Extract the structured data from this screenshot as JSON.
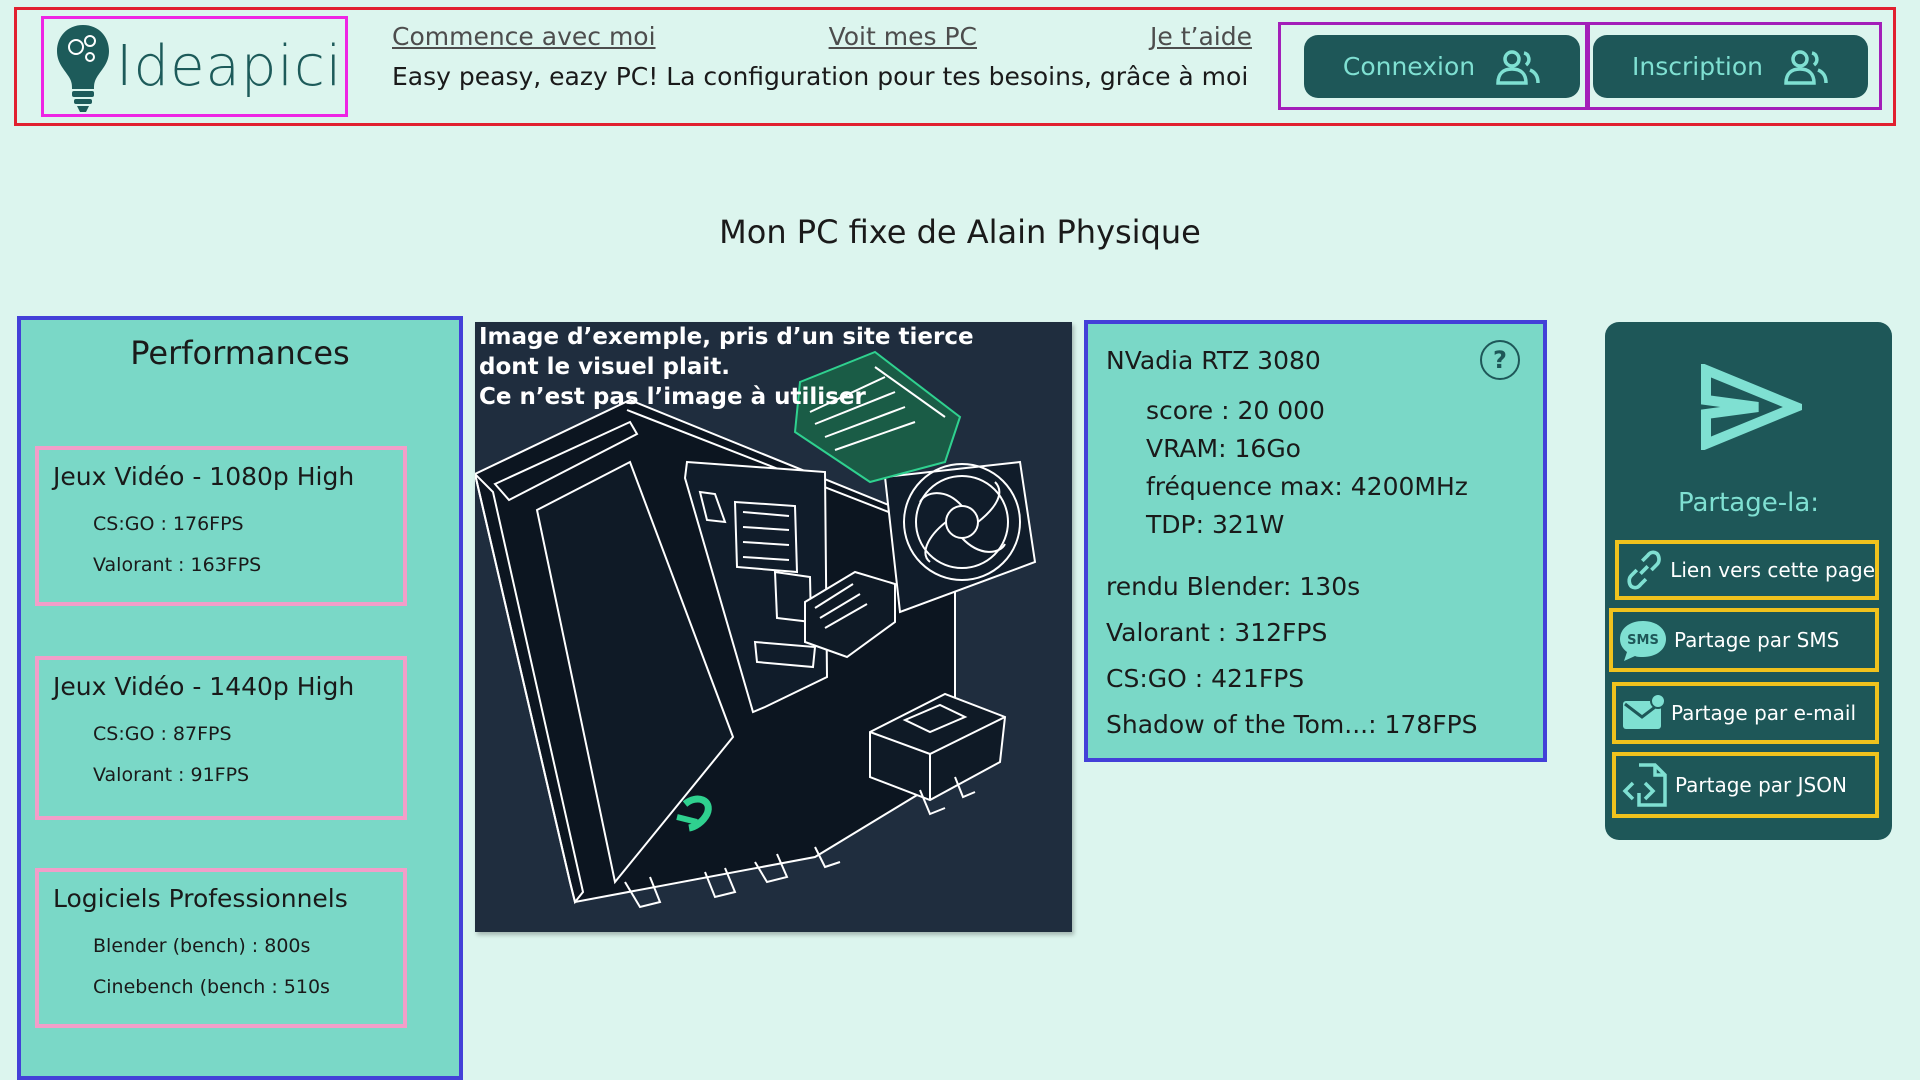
{
  "header": {
    "logo": "Ideapici",
    "nav": [
      "Commence avec moi",
      "Voit mes PC",
      "Je t’aide"
    ],
    "tagline": "Easy peasy, eazy PC! La configuration pour tes besoins, grâce à moi",
    "login": "Connexion",
    "signup": "Inscription"
  },
  "page_title": "Mon PC fixe de Alain Physique",
  "performances": {
    "title": "Performances",
    "cards": [
      {
        "title": "Jeux Vidéo - 1080p High",
        "rows": [
          "CS:GO : 176FPS",
          "Valorant : 163FPS"
        ]
      },
      {
        "title": "Jeux Vidéo - 1440p High",
        "rows": [
          "CS:GO : 87FPS",
          "Valorant : 91FPS"
        ]
      },
      {
        "title": "Logiciels Professionnels",
        "rows": [
          "Blender (bench) : 800s",
          "Cinebench (bench : 510s"
        ]
      }
    ]
  },
  "image_panel": {
    "caption": [
      "Image d’exemple, pris d’un site tierce",
      "dont le visuel plait.",
      "Ce n’est pas l’image à utiliser"
    ],
    "icon": "pc-case-illustration"
  },
  "gpu": {
    "name": "NVadia RTZ 3080",
    "help": "?",
    "specs": [
      "score : 20 000",
      "VRAM: 16Go",
      "fréquence max: 4200MHz",
      "TDP: 321W"
    ],
    "benchmarks": [
      "rendu Blender: 130s",
      "Valorant : 312FPS",
      "CS:GO : 421FPS",
      "Shadow of the Tom...: 178FPS"
    ]
  },
  "share": {
    "title": "Partage-la:",
    "items": [
      "Lien vers cette page",
      "Partage par SMS",
      "Partage par e-mail",
      "Partage par JSON"
    ],
    "sms_badge": "SMS"
  },
  "colors": {
    "background": "#dcf5ee",
    "panel": "#7ad8c7",
    "dark": "#1e5758",
    "accent": "#7fe0d2"
  }
}
